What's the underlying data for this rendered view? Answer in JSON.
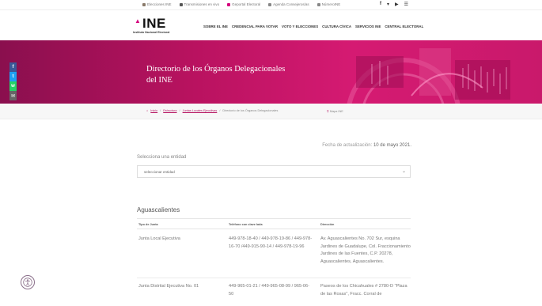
{
  "topbar": {
    "links": [
      "Elecciones INE",
      "Transmisiones en vivo",
      "Geportal Electoral",
      "Agenda Consejeros/as",
      "NúmeroINE"
    ],
    "dot_colors": [
      "#8a7a6a",
      "#555555",
      "#d5007d",
      "#888888",
      "#888888"
    ],
    "social": [
      "f",
      "▾",
      "▶",
      "☰"
    ]
  },
  "header": {
    "logo_word": "INE",
    "logo_sub": "Instituto Nacional Electoral",
    "nav": [
      "SOBRE EL INE",
      "CREDENCIAL PARA VOTAR",
      "VOTO Y ELECCIONES",
      "CULTURA CÍVICA",
      "SERVICIOS INE",
      "CENTRAL ELECTORAL"
    ]
  },
  "hero": {
    "title": "Directorio de los Órganos Delegacionales del INE"
  },
  "float_social": [
    {
      "icon": "facebook-icon",
      "glyph": "f",
      "color": "#3b5998"
    },
    {
      "icon": "twitter-icon",
      "glyph": "t",
      "color": "#1da1f2"
    },
    {
      "icon": "whatsapp-icon",
      "glyph": "w",
      "color": "#25d366"
    },
    {
      "icon": "email-icon",
      "glyph": "✉",
      "color": "#666666"
    }
  ],
  "breadcrumb": {
    "home": "Inicio",
    "links": [
      "Estructura",
      "Juntas Locales Ejecutivas"
    ],
    "current": "Directorio de los Órganos Delegacionales",
    "map_label": "Mapa INE"
  },
  "content": {
    "updated_label": "Fecha de actualización:",
    "updated_date": "10 de mayo 2021.",
    "select_label": "Selecciona una entidad",
    "select_value": "seleccionar entidad",
    "section_title": "Aguascalientes",
    "table": {
      "headers": [
        "Tipo de Junta",
        "Teléfono con clave lada",
        "Dirección"
      ],
      "rows": [
        {
          "type": "Junta Local Ejecutiva",
          "phone": "449-978-18-40 / 449-978-19-86 / 449-978-16-70 /449-915-90-14 / 449-978-19-96",
          "address": "Av. Aguascalientes No. 702 Sur, esquina Jardines de Guadalupe, Col. Fraccionamiento Jardines de las Fuentes, C.P. 20278, Aguascalientes, Aguascalientes."
        },
        {
          "type": "Junta Distrital Ejecutiva No. 01",
          "phone": "449-965-01-21 / 449-965-08-99 / 965-06-50",
          "address": "Paseos de los Chicahuales # 2780-D \"Plaza de las Rosas\", Fracc. Corral de"
        }
      ]
    }
  },
  "colors": {
    "brand": "#d5007d",
    "hero_dark": "#8a0f4e",
    "link": "#b5105f"
  }
}
